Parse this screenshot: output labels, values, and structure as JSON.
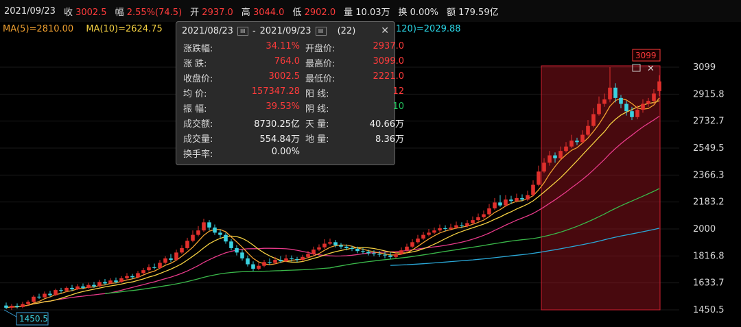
{
  "topbar": {
    "date": "2021/09/23",
    "close_label": "收",
    "close_value": "3002.5",
    "change_label": "幅",
    "change_value": "2.55%(74.5)",
    "open_label": "开",
    "open_value": "2937.0",
    "high_label": "高",
    "high_value": "3044.0",
    "low_label": "低",
    "low_value": "2902.0",
    "vol_label": "量",
    "vol_value": "10.03万",
    "turn_label": "换",
    "turn_value": "0.00%",
    "amount_label": "额",
    "amount_value": "179.59亿"
  },
  "ma": {
    "ma5": "MA(5)=2810.00",
    "ma10": "MA(10)=2624.75",
    "ma120": "120)=2029.88"
  },
  "popup": {
    "start_date": "2021/08/23",
    "end_date": "2021/09/23",
    "count": "(22)",
    "rows": [
      {
        "k1": "涨跌幅:",
        "v1": "34.11%",
        "c1": "red",
        "k2": "开盘价:",
        "v2": "2937.0",
        "c2": "red"
      },
      {
        "k1": "涨  跌:",
        "v1": "764.0",
        "c1": "red",
        "k2": "最高价:",
        "v2": "3099.0",
        "c2": "red"
      },
      {
        "k1": "收盘价:",
        "v1": "3002.5",
        "c1": "red",
        "k2": "最低价:",
        "v2": "2221.0",
        "c2": "red"
      },
      {
        "k1": "均  价:",
        "v1": "157347.28",
        "c1": "red",
        "k2": "阳  线:",
        "v2": "12",
        "c2": "red"
      },
      {
        "k1": "振  幅:",
        "v1": "39.53%",
        "c1": "red",
        "k2": "阴  线:",
        "v2": "10",
        "c2": "green"
      },
      {
        "k1": "成交额:",
        "v1": "8730.25亿",
        "c1": "white",
        "k2": "天  量:",
        "v2": "40.66万",
        "c2": "white"
      },
      {
        "k1": "成交量:",
        "v1": "554.84万",
        "c1": "white",
        "k2": "地  量:",
        "v2": "8.36万",
        "c2": "white"
      },
      {
        "k1": "换手率:",
        "v1": "0.00%",
        "c1": "white",
        "k2": "",
        "v2": "",
        "c2": "white"
      }
    ]
  },
  "marks": {
    "low_label": "1450.5",
    "high_label": "3099"
  },
  "colors": {
    "up": "#e0302c",
    "down": "#3ad1e0",
    "ma5": "#f5d142",
    "ma10": "#f0a030",
    "ma20": "#e83a8a",
    "ma60": "#3ab84a",
    "ma120": "#2aa8d8"
  },
  "chart_data": {
    "type": "candlestick",
    "y_ticks": [
      3099,
      2915.8,
      2732.7,
      2549.5,
      2366.3,
      2183.2,
      2000,
      1816.8,
      1633.7,
      1450.5
    ],
    "ylim": [
      1450.5,
      3099
    ],
    "selection": {
      "start": "2021/08/23",
      "end": "2021/09/23",
      "count": 22
    },
    "candles": [
      [
        1480,
        1465,
        1500,
        1455
      ],
      [
        1465,
        1478,
        1490,
        1450
      ],
      [
        1478,
        1470,
        1495,
        1460
      ],
      [
        1470,
        1490,
        1505,
        1462
      ],
      [
        1490,
        1505,
        1515,
        1480
      ],
      [
        1505,
        1540,
        1550,
        1495
      ],
      [
        1540,
        1535,
        1560,
        1525
      ],
      [
        1535,
        1560,
        1575,
        1530
      ],
      [
        1560,
        1550,
        1580,
        1540
      ],
      [
        1550,
        1585,
        1595,
        1545
      ],
      [
        1585,
        1580,
        1600,
        1565
      ],
      [
        1580,
        1600,
        1610,
        1570
      ],
      [
        1600,
        1590,
        1620,
        1580
      ],
      [
        1590,
        1610,
        1625,
        1585
      ],
      [
        1610,
        1600,
        1630,
        1590
      ],
      [
        1600,
        1620,
        1635,
        1595
      ],
      [
        1620,
        1610,
        1640,
        1600
      ],
      [
        1610,
        1640,
        1655,
        1605
      ],
      [
        1640,
        1630,
        1660,
        1620
      ],
      [
        1630,
        1650,
        1665,
        1625
      ],
      [
        1650,
        1640,
        1670,
        1630
      ],
      [
        1640,
        1665,
        1680,
        1635
      ],
      [
        1665,
        1680,
        1700,
        1655
      ],
      [
        1680,
        1672,
        1695,
        1660
      ],
      [
        1672,
        1700,
        1715,
        1665
      ],
      [
        1700,
        1720,
        1735,
        1690
      ],
      [
        1720,
        1740,
        1760,
        1710
      ],
      [
        1740,
        1735,
        1765,
        1725
      ],
      [
        1735,
        1770,
        1790,
        1730
      ],
      [
        1770,
        1800,
        1815,
        1760
      ],
      [
        1800,
        1790,
        1830,
        1775
      ],
      [
        1790,
        1840,
        1860,
        1785
      ],
      [
        1840,
        1870,
        1890,
        1830
      ],
      [
        1870,
        1920,
        1940,
        1860
      ],
      [
        1920,
        1960,
        1990,
        1910
      ],
      [
        1960,
        1990,
        2020,
        1950
      ],
      [
        1990,
        2045,
        2070,
        1980
      ],
      [
        2045,
        2010,
        2060,
        1990
      ],
      [
        2010,
        1975,
        2030,
        1960
      ],
      [
        1975,
        1960,
        1995,
        1940
      ],
      [
        1960,
        1915,
        1975,
        1900
      ],
      [
        1915,
        1870,
        1930,
        1855
      ],
      [
        1870,
        1840,
        1890,
        1820
      ],
      [
        1840,
        1800,
        1860,
        1785
      ],
      [
        1800,
        1760,
        1820,
        1745
      ],
      [
        1760,
        1730,
        1780,
        1715
      ],
      [
        1730,
        1750,
        1770,
        1720
      ],
      [
        1750,
        1775,
        1790,
        1740
      ],
      [
        1775,
        1770,
        1800,
        1755
      ],
      [
        1770,
        1790,
        1810,
        1760
      ],
      [
        1790,
        1780,
        1815,
        1770
      ],
      [
        1780,
        1800,
        1825,
        1775
      ],
      [
        1800,
        1795,
        1820,
        1780
      ],
      [
        1795,
        1790,
        1810,
        1775
      ],
      [
        1790,
        1810,
        1825,
        1780
      ],
      [
        1810,
        1830,
        1850,
        1800
      ],
      [
        1830,
        1860,
        1880,
        1820
      ],
      [
        1860,
        1875,
        1895,
        1850
      ],
      [
        1875,
        1900,
        1930,
        1865
      ],
      [
        1900,
        1910,
        1935,
        1890
      ],
      [
        1910,
        1890,
        1925,
        1875
      ],
      [
        1890,
        1880,
        1905,
        1865
      ],
      [
        1880,
        1870,
        1895,
        1855
      ],
      [
        1870,
        1865,
        1885,
        1850
      ],
      [
        1865,
        1850,
        1880,
        1835
      ],
      [
        1850,
        1845,
        1870,
        1830
      ],
      [
        1845,
        1835,
        1860,
        1820
      ],
      [
        1835,
        1830,
        1855,
        1815
      ],
      [
        1830,
        1825,
        1850,
        1810
      ],
      [
        1825,
        1820,
        1845,
        1800
      ],
      [
        1820,
        1810,
        1840,
        1795
      ],
      [
        1810,
        1830,
        1850,
        1800
      ],
      [
        1830,
        1855,
        1875,
        1825
      ],
      [
        1855,
        1880,
        1900,
        1845
      ],
      [
        1880,
        1910,
        1930,
        1870
      ],
      [
        1910,
        1935,
        1960,
        1900
      ],
      [
        1935,
        1960,
        1980,
        1925
      ],
      [
        1960,
        1975,
        2000,
        1950
      ],
      [
        1975,
        1990,
        2010,
        1965
      ],
      [
        1990,
        2005,
        2030,
        1980
      ],
      [
        2005,
        2000,
        2025,
        1985
      ],
      [
        2000,
        2010,
        2035,
        1990
      ],
      [
        2010,
        2025,
        2050,
        2000
      ],
      [
        2025,
        2020,
        2045,
        2005
      ],
      [
        2020,
        2040,
        2060,
        2010
      ],
      [
        2040,
        2060,
        2085,
        2030
      ],
      [
        2060,
        2080,
        2105,
        2050
      ],
      [
        2080,
        2100,
        2125,
        2070
      ],
      [
        2100,
        2140,
        2170,
        2090
      ],
      [
        2140,
        2180,
        2210,
        2130
      ],
      [
        2180,
        2160,
        2230,
        2150
      ],
      [
        2160,
        2200,
        2230,
        2150
      ],
      [
        2200,
        2190,
        2225,
        2170
      ],
      [
        2190,
        2210,
        2240,
        2180
      ],
      [
        2210,
        2200,
        2235,
        2190
      ],
      [
        2200,
        2230,
        2260,
        2190
      ],
      [
        2230,
        2300,
        2330,
        2221
      ],
      [
        2300,
        2390,
        2430,
        2290
      ],
      [
        2390,
        2450,
        2480,
        2380
      ],
      [
        2450,
        2500,
        2530,
        2430
      ],
      [
        2500,
        2480,
        2520,
        2450
      ],
      [
        2480,
        2530,
        2560,
        2470
      ],
      [
        2530,
        2560,
        2590,
        2520
      ],
      [
        2560,
        2600,
        2640,
        2550
      ],
      [
        2600,
        2590,
        2620,
        2570
      ],
      [
        2590,
        2640,
        2670,
        2580
      ],
      [
        2640,
        2700,
        2740,
        2630
      ],
      [
        2700,
        2780,
        2820,
        2690
      ],
      [
        2780,
        2850,
        2900,
        2770
      ],
      [
        2850,
        2880,
        2920,
        2830
      ],
      [
        2880,
        2960,
        3099,
        2860
      ],
      [
        2960,
        2890,
        2990,
        2860
      ],
      [
        2890,
        2850,
        2910,
        2820
      ],
      [
        2850,
        2800,
        2870,
        2770
      ],
      [
        2800,
        2760,
        2830,
        2740
      ],
      [
        2760,
        2810,
        2840,
        2745
      ],
      [
        2810,
        2850,
        2880,
        2790
      ],
      [
        2850,
        2870,
        2890,
        2830
      ],
      [
        2870,
        2920,
        2950,
        2850
      ],
      [
        2937,
        3002.5,
        3044,
        2902
      ]
    ]
  }
}
